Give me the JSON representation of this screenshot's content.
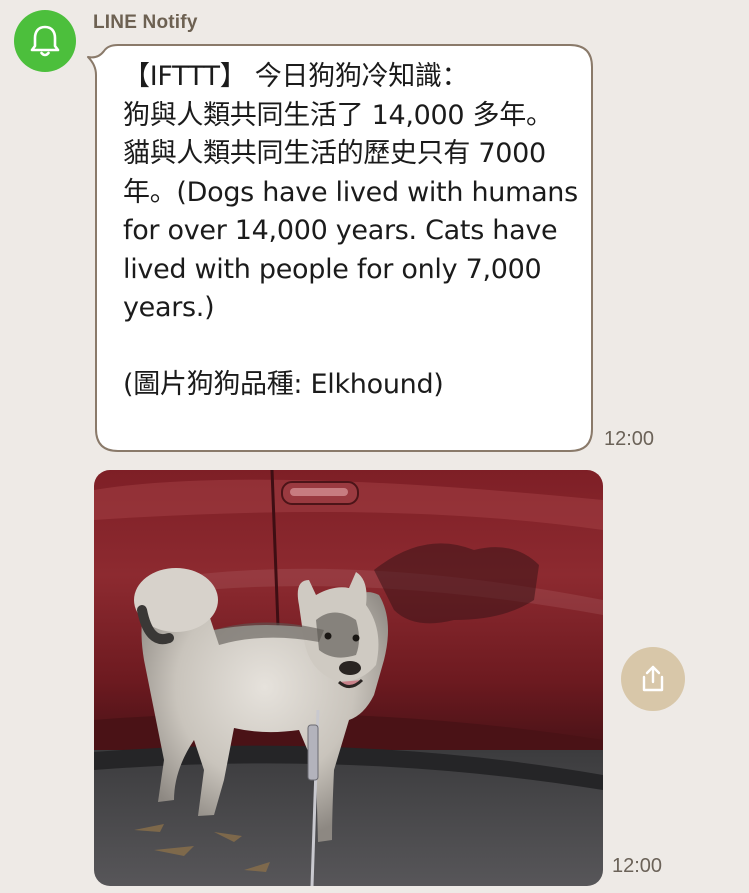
{
  "sender": {
    "name": "LINE Notify",
    "avatar_icon": "bell-icon",
    "avatar_color": "#4cbf3c"
  },
  "messages": [
    {
      "type": "text",
      "text": "【IFTTT】 今日狗狗冷知識：\n狗與人類共同生活了 14,000 多年。貓與人類共同生活的歷史只有 7000 年。(Dogs have lived with humans for over 14,000 years. Cats have lived with people for only 7,000 years.)\n\n(圖片狗狗品種: Elkhound)",
      "time": "12:00"
    },
    {
      "type": "image",
      "image_alt": "Elkhound dog standing next to a red car",
      "time": "12:00",
      "share_icon": "share-icon"
    }
  ],
  "colors": {
    "background": "#eeeae6",
    "bubble_border": "#8a7a6a",
    "share_button": "#d8c7a9"
  }
}
